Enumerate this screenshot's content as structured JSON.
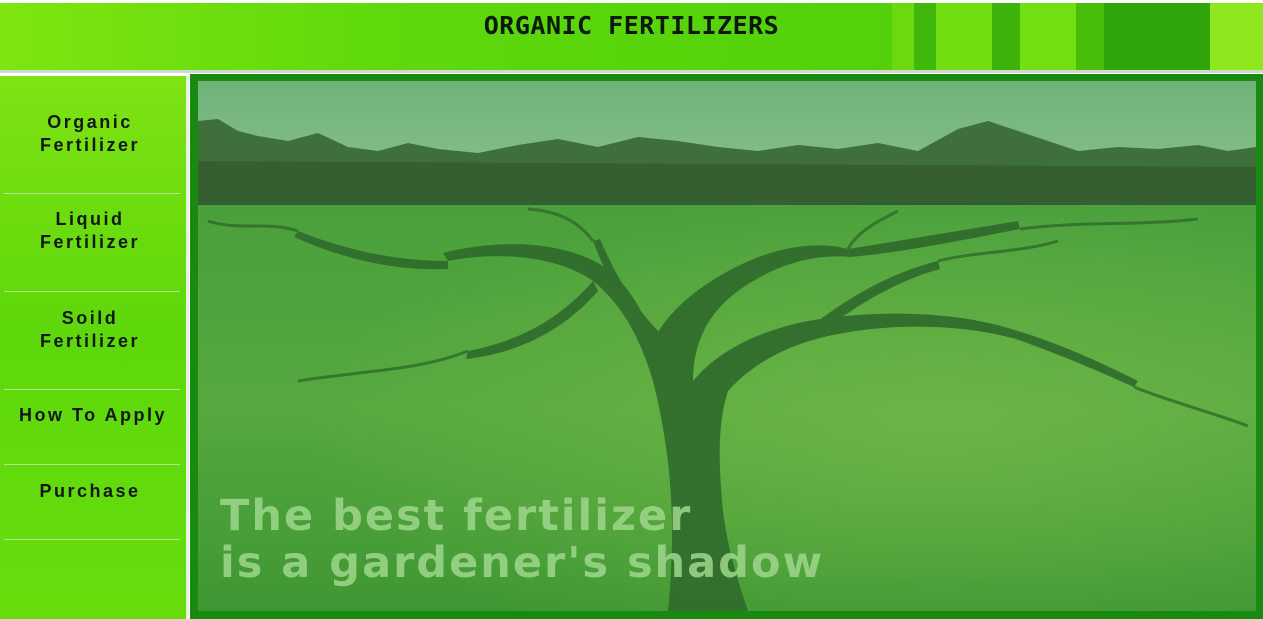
{
  "header": {
    "title": "ORGANIC FERTILIZERS"
  },
  "sidebar": {
    "items": [
      {
        "label": "Organic\nFertilizer"
      },
      {
        "label": "Liquid\nFertilizer"
      },
      {
        "label": "Soild\nFertilizer"
      },
      {
        "label": "How To Apply"
      },
      {
        "label": "Purchase"
      }
    ]
  },
  "hero": {
    "quote_line1": "The best fertilizer",
    "quote_line2": "is a gardener's shadow"
  },
  "colors": {
    "header_green": "#5fd90c",
    "sidebar_green": "#66dc0d",
    "frame_green": "#188a12"
  }
}
